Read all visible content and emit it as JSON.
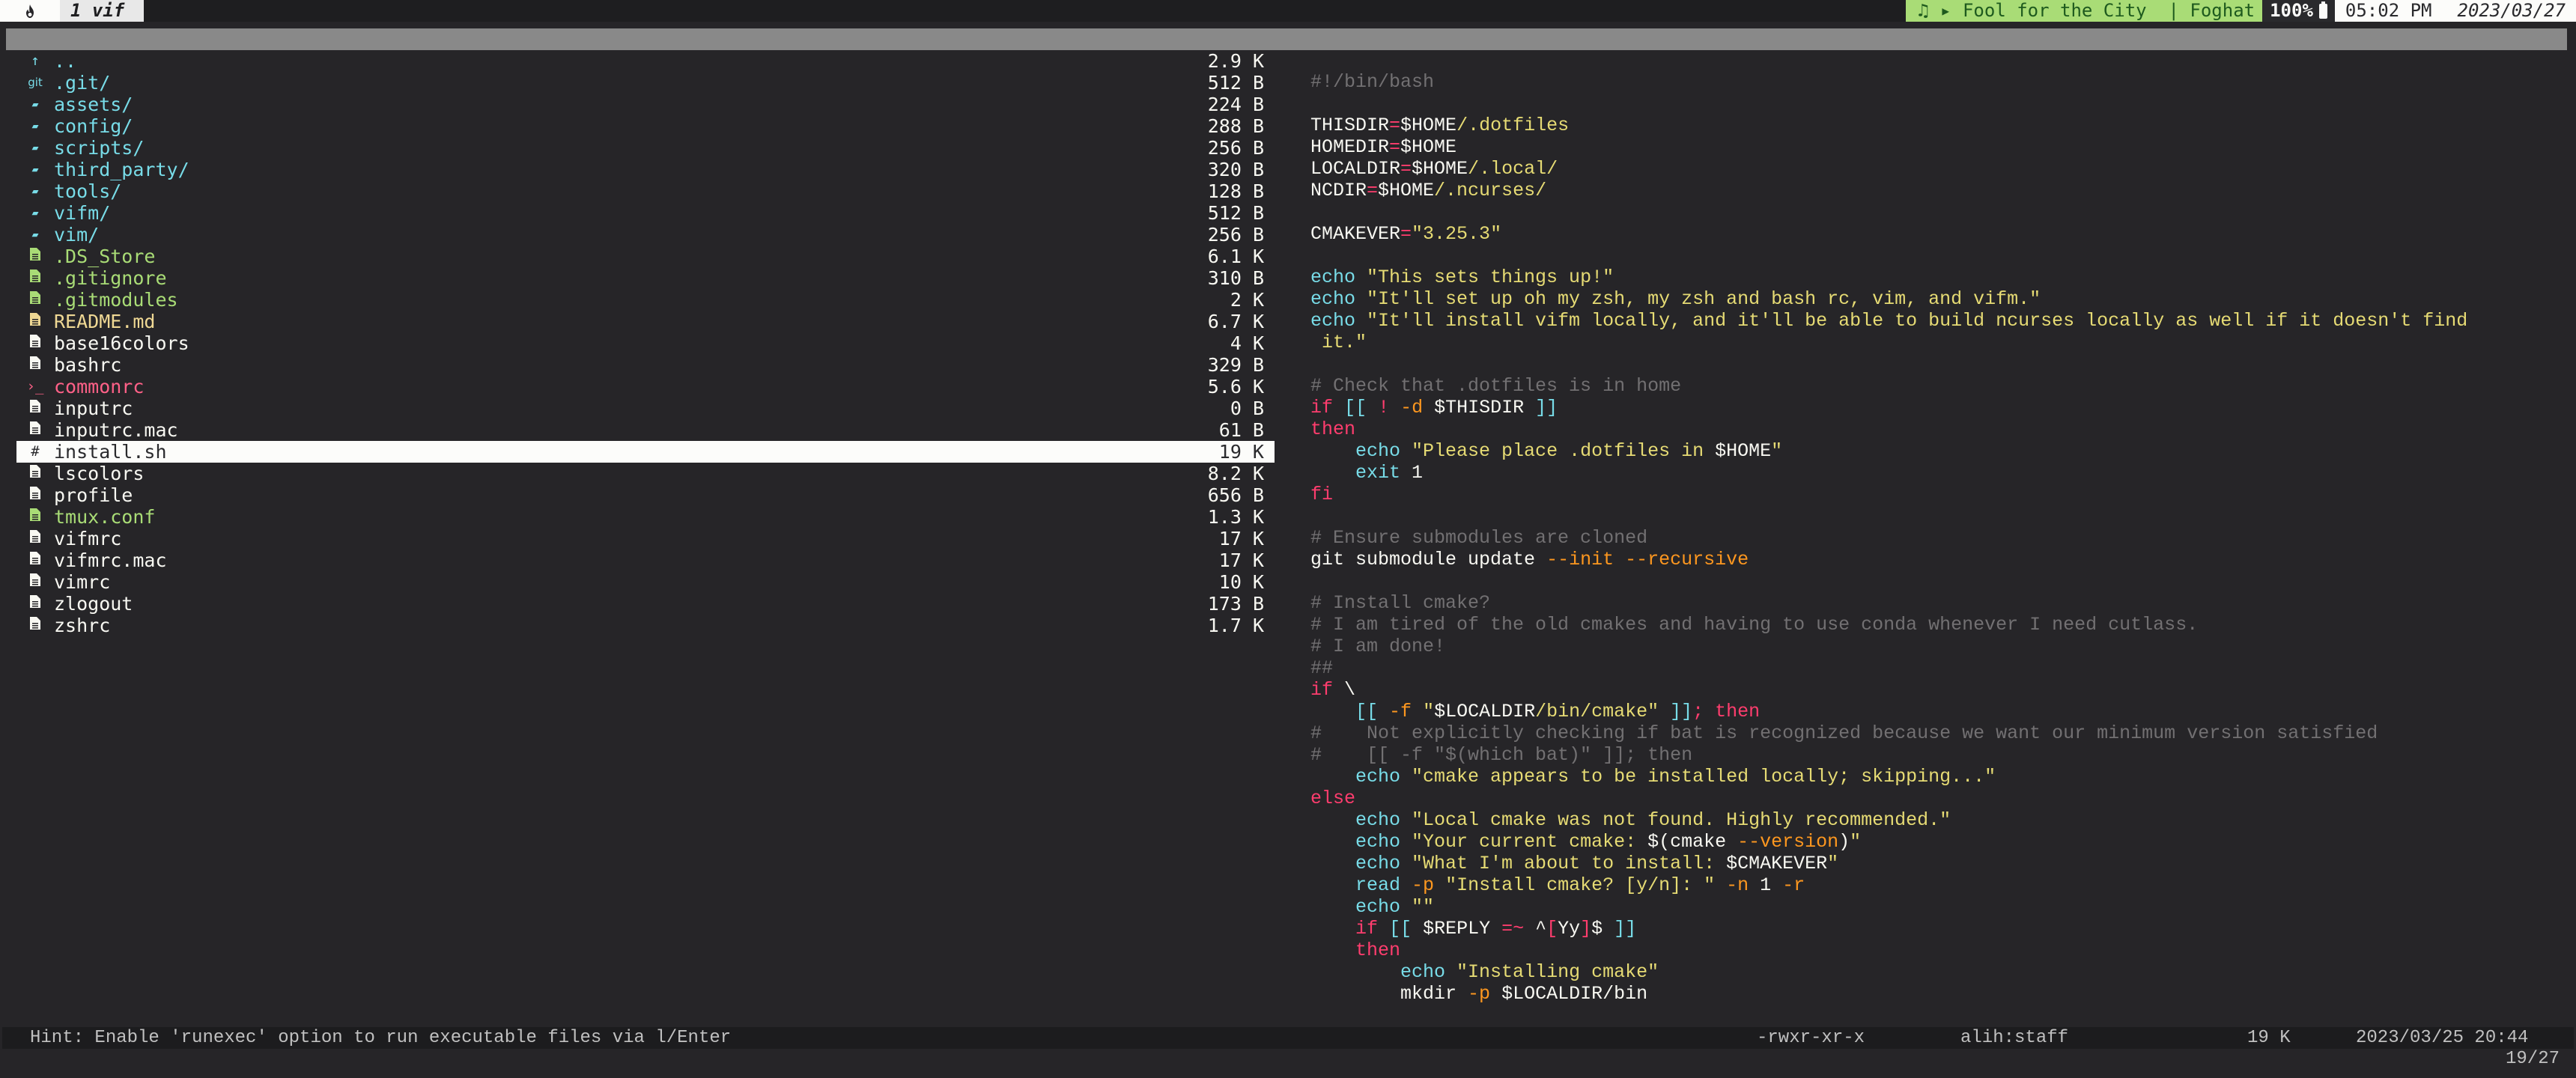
{
  "tmux": {
    "session_icon": "flame-icon",
    "window_label": "1 vif",
    "music_icon": "♫",
    "play_icon": "▶",
    "now_playing": "Fool for the City  | Foghat",
    "battery": "100%",
    "time": "05:02 PM",
    "date": "2023/03/27"
  },
  "files": [
    {
      "icon": "↑",
      "icon_name": "parent-dir-icon",
      "name": "..",
      "size": "2.9 K",
      "kind": "dir"
    },
    {
      "icon": "git",
      "icon_name": "git-icon",
      "name": ".git/",
      "size": "512 B",
      "kind": "dir"
    },
    {
      "icon": "▰",
      "icon_name": "folder-icon",
      "name": "assets/",
      "size": "224 B",
      "kind": "dir"
    },
    {
      "icon": "▰",
      "icon_name": "folder-icon",
      "name": "config/",
      "size": "288 B",
      "kind": "dir"
    },
    {
      "icon": "▰",
      "icon_name": "folder-icon",
      "name": "scripts/",
      "size": "256 B",
      "kind": "dir"
    },
    {
      "icon": "▰",
      "icon_name": "folder-icon",
      "name": "third_party/",
      "size": "320 B",
      "kind": "dir"
    },
    {
      "icon": "▰",
      "icon_name": "folder-icon",
      "name": "tools/",
      "size": "128 B",
      "kind": "dir"
    },
    {
      "icon": "▰",
      "icon_name": "folder-icon",
      "name": "vifm/",
      "size": "512 B",
      "kind": "dir"
    },
    {
      "icon": "▰",
      "icon_name": "folder-icon",
      "name": "vim/",
      "size": "256 B",
      "kind": "dir"
    },
    {
      "icon": "🗎",
      "icon_name": "file-icon",
      "name": ".DS_Store",
      "size": "6.1 K",
      "kind": "hidden"
    },
    {
      "icon": "🗎",
      "icon_name": "file-icon",
      "name": ".gitignore",
      "size": "310 B",
      "kind": "hidden"
    },
    {
      "icon": "🗎",
      "icon_name": "file-icon",
      "name": ".gitmodules",
      "size": "2 K",
      "kind": "hidden"
    },
    {
      "icon": "🗎",
      "icon_name": "markdown-file-icon",
      "name": "README.md",
      "size": "6.7 K",
      "kind": "readme"
    },
    {
      "icon": "🗎",
      "icon_name": "file-icon",
      "name": "base16colors",
      "size": "4 K",
      "kind": "plain"
    },
    {
      "icon": "🗎",
      "icon_name": "file-icon",
      "name": "bashrc",
      "size": "329 B",
      "kind": "plain"
    },
    {
      "icon": "›_",
      "icon_name": "terminal-icon",
      "name": "commonrc",
      "size": "5.6 K",
      "kind": "exec"
    },
    {
      "icon": "🗎",
      "icon_name": "file-icon",
      "name": "inputrc",
      "size": "0 B",
      "kind": "plain"
    },
    {
      "icon": "🗎",
      "icon_name": "file-icon",
      "name": "inputrc.mac",
      "size": "61 B",
      "kind": "plain"
    },
    {
      "icon": "#",
      "icon_name": "shell-script-icon",
      "name": "install.sh",
      "size": "19 K",
      "kind": "selected"
    },
    {
      "icon": "🗎",
      "icon_name": "file-icon",
      "name": "lscolors",
      "size": "8.2 K",
      "kind": "plain"
    },
    {
      "icon": "🗎",
      "icon_name": "file-icon",
      "name": "profile",
      "size": "656 B",
      "kind": "plain"
    },
    {
      "icon": "🗎",
      "icon_name": "file-icon",
      "name": "tmux.conf",
      "size": "1.3 K",
      "kind": "hidden"
    },
    {
      "icon": "🗎",
      "icon_name": "file-icon",
      "name": "vifmrc",
      "size": "17 K",
      "kind": "plain"
    },
    {
      "icon": "🗎",
      "icon_name": "file-icon",
      "name": "vifmrc.mac",
      "size": "17 K",
      "kind": "plain"
    },
    {
      "icon": "🗎",
      "icon_name": "file-icon",
      "name": "vimrc",
      "size": "10 K",
      "kind": "plain"
    },
    {
      "icon": "🗎",
      "icon_name": "file-icon",
      "name": "zlogout",
      "size": "173 B",
      "kind": "plain"
    },
    {
      "icon": "🗎",
      "icon_name": "file-icon",
      "name": "zshrc",
      "size": "1.7 K",
      "kind": "plain"
    }
  ],
  "preview": [
    [
      [
        "cm",
        "#!/bin/bash"
      ]
    ],
    [],
    [
      [
        "pl",
        "THISDIR"
      ],
      [
        "eq",
        "="
      ],
      [
        "pl",
        "$HOME"
      ],
      [
        "st",
        "/.dotfiles"
      ]
    ],
    [
      [
        "pl",
        "HOMEDIR"
      ],
      [
        "eq",
        "="
      ],
      [
        "pl",
        "$HOME"
      ]
    ],
    [
      [
        "pl",
        "LOCALDIR"
      ],
      [
        "eq",
        "="
      ],
      [
        "pl",
        "$HOME"
      ],
      [
        "st",
        "/.local/"
      ]
    ],
    [
      [
        "pl",
        "NCDIR"
      ],
      [
        "eq",
        "="
      ],
      [
        "pl",
        "$HOME"
      ],
      [
        "st",
        "/.ncurses/"
      ]
    ],
    [],
    [
      [
        "pl",
        "CMAKEVER"
      ],
      [
        "eq",
        "="
      ],
      [
        "st",
        "\"3.25.3\""
      ]
    ],
    [],
    [
      [
        "bi",
        "echo"
      ],
      [
        "st",
        " \"This sets things up!\""
      ]
    ],
    [
      [
        "bi",
        "echo"
      ],
      [
        "st",
        " \"It'll set up oh my zsh, my zsh and bash rc, vim, and vifm.\""
      ]
    ],
    [
      [
        "bi",
        "echo"
      ],
      [
        "st",
        " \"It'll install vifm locally, and it'll be able to build ncurses locally as well if it doesn't find"
      ]
    ],
    [
      [
        "st",
        " it.\""
      ]
    ],
    [],
    [
      [
        "cm",
        "# Check that .dotfiles is in home"
      ]
    ],
    [
      [
        "kw",
        "if"
      ],
      [
        "pl",
        " "
      ],
      [
        "bi",
        "[["
      ],
      [
        "pl",
        " "
      ],
      [
        "kw",
        "!"
      ],
      [
        "pl",
        " "
      ],
      [
        "op",
        "-d"
      ],
      [
        "pl",
        " $THISDIR "
      ],
      [
        "bi",
        "]]"
      ]
    ],
    [
      [
        "kw",
        "then"
      ]
    ],
    [
      [
        "pl",
        "    "
      ],
      [
        "bi",
        "echo"
      ],
      [
        "st",
        " \"Please place .dotfiles in "
      ],
      [
        "pl",
        "$HOME"
      ],
      [
        "st",
        "\""
      ]
    ],
    [
      [
        "pl",
        "    "
      ],
      [
        "bi",
        "exit"
      ],
      [
        "pl",
        " 1"
      ]
    ],
    [
      [
        "kw",
        "fi"
      ]
    ],
    [],
    [
      [
        "cm",
        "# Ensure submodules are cloned"
      ]
    ],
    [
      [
        "pl",
        "git submodule update "
      ],
      [
        "op",
        "--init --recursive"
      ]
    ],
    [],
    [
      [
        "cm",
        "# Install cmake?"
      ]
    ],
    [
      [
        "cm",
        "# I am tired of the old cmakes and having to use conda whenever I need cutlass."
      ]
    ],
    [
      [
        "cm",
        "# I am done!"
      ]
    ],
    [
      [
        "cm",
        "##"
      ]
    ],
    [
      [
        "kw",
        "if"
      ],
      [
        "pl",
        " \\"
      ]
    ],
    [
      [
        "pl",
        "    "
      ],
      [
        "bi",
        "[["
      ],
      [
        "pl",
        " "
      ],
      [
        "op",
        "-f"
      ],
      [
        "st",
        " \""
      ],
      [
        "pl",
        "$LOCALDIR"
      ],
      [
        "st",
        "/bin/cmake\""
      ],
      [
        "pl",
        " "
      ],
      [
        "bi",
        "]]"
      ],
      [
        "kw",
        "; then"
      ]
    ],
    [
      [
        "cm",
        "#    Not explicitly checking if bat is recognized because we want our minimum version satisfied"
      ]
    ],
    [
      [
        "cm",
        "#    [[ -f \"$(which bat)\" ]]; then"
      ]
    ],
    [
      [
        "pl",
        "    "
      ],
      [
        "bi",
        "echo"
      ],
      [
        "st",
        " \"cmake appears to be installed locally; skipping...\""
      ]
    ],
    [
      [
        "kw",
        "else"
      ]
    ],
    [
      [
        "pl",
        "    "
      ],
      [
        "bi",
        "echo"
      ],
      [
        "st",
        " \"Local cmake was not found. Highly recommended.\""
      ]
    ],
    [
      [
        "pl",
        "    "
      ],
      [
        "bi",
        "echo"
      ],
      [
        "st",
        " \"Your current cmake: "
      ],
      [
        "pl",
        "$(cmake "
      ],
      [
        "op",
        "--version"
      ],
      [
        "pl",
        ")"
      ],
      [
        "st",
        "\""
      ]
    ],
    [
      [
        "pl",
        "    "
      ],
      [
        "bi",
        "echo"
      ],
      [
        "st",
        " \"What I'm about to install: "
      ],
      [
        "pl",
        "$CMAKEVER"
      ],
      [
        "st",
        "\""
      ]
    ],
    [
      [
        "pl",
        "    "
      ],
      [
        "bi",
        "read"
      ],
      [
        "pl",
        " "
      ],
      [
        "op",
        "-p"
      ],
      [
        "st",
        " \"Install cmake? [y/n]: \""
      ],
      [
        "pl",
        " "
      ],
      [
        "op",
        "-n"
      ],
      [
        "pl",
        " 1 "
      ],
      [
        "op",
        "-r"
      ]
    ],
    [
      [
        "pl",
        "    "
      ],
      [
        "bi",
        "echo"
      ],
      [
        "st",
        " \"\""
      ]
    ],
    [
      [
        "pl",
        "    "
      ],
      [
        "kw",
        "if"
      ],
      [
        "pl",
        " "
      ],
      [
        "bi",
        "[["
      ],
      [
        "pl",
        " $REPLY "
      ],
      [
        "eq",
        "=~"
      ],
      [
        "pl",
        " ^"
      ],
      [
        "kw",
        "["
      ],
      [
        "pl",
        "Yy"
      ],
      [
        "kw",
        "]"
      ],
      [
        "pl",
        "$ "
      ],
      [
        "bi",
        "]]"
      ]
    ],
    [
      [
        "pl",
        "    "
      ],
      [
        "kw",
        "then"
      ]
    ],
    [
      [
        "pl",
        "        "
      ],
      [
        "bi",
        "echo"
      ],
      [
        "st",
        " \"Installing cmake\""
      ]
    ],
    [
      [
        "pl",
        "        mkdir "
      ],
      [
        "op",
        "-p"
      ],
      [
        "pl",
        " $LOCALDIR/bin"
      ]
    ]
  ],
  "status": {
    "hint": "Hint: Enable 'runexec' option to run executable files via l/Enter",
    "permissions": "-rwxr-xr-x",
    "owner": "alih:staff",
    "size": "19 K",
    "mtime": "2023/03/25 20:44",
    "position": "19/27"
  }
}
